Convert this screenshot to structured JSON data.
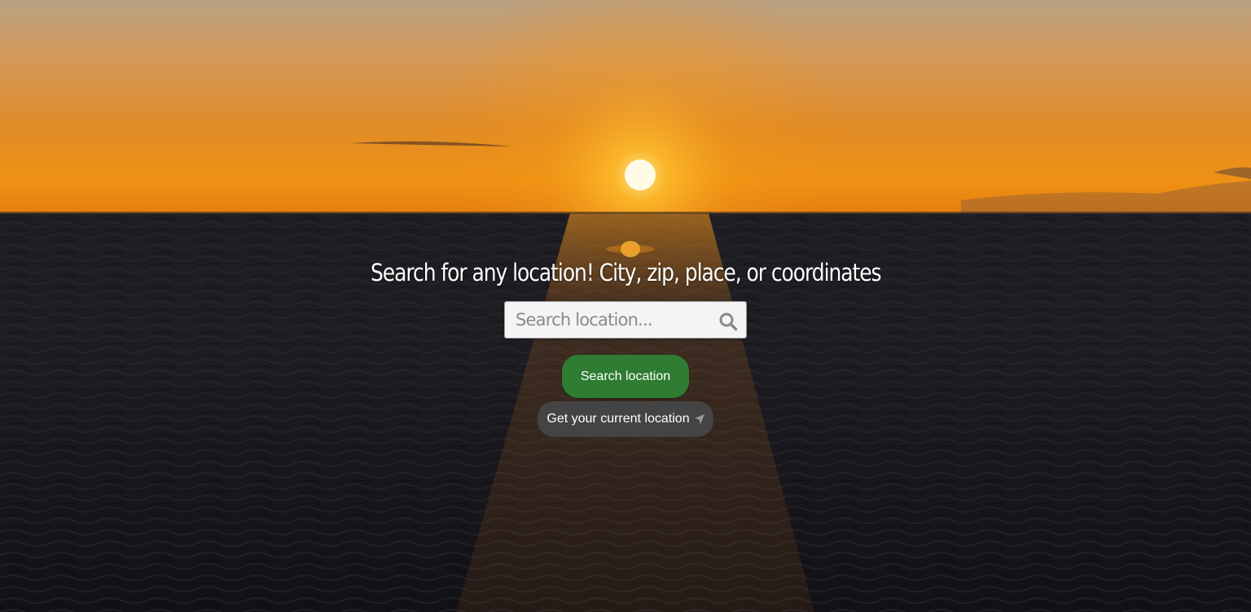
{
  "hero": {
    "heading": "Search for any location! City, zip, place, or coordinates"
  },
  "search": {
    "placeholder": "Search location...",
    "value": "",
    "icon": "search-icon"
  },
  "buttons": {
    "search_label": "Search location",
    "current_location_label": "Get your current location",
    "current_location_icon": "location-arrow-icon"
  },
  "colors": {
    "search_button": "#2e7d32",
    "location_button": "#444444",
    "heading_text": "#ffffff"
  }
}
